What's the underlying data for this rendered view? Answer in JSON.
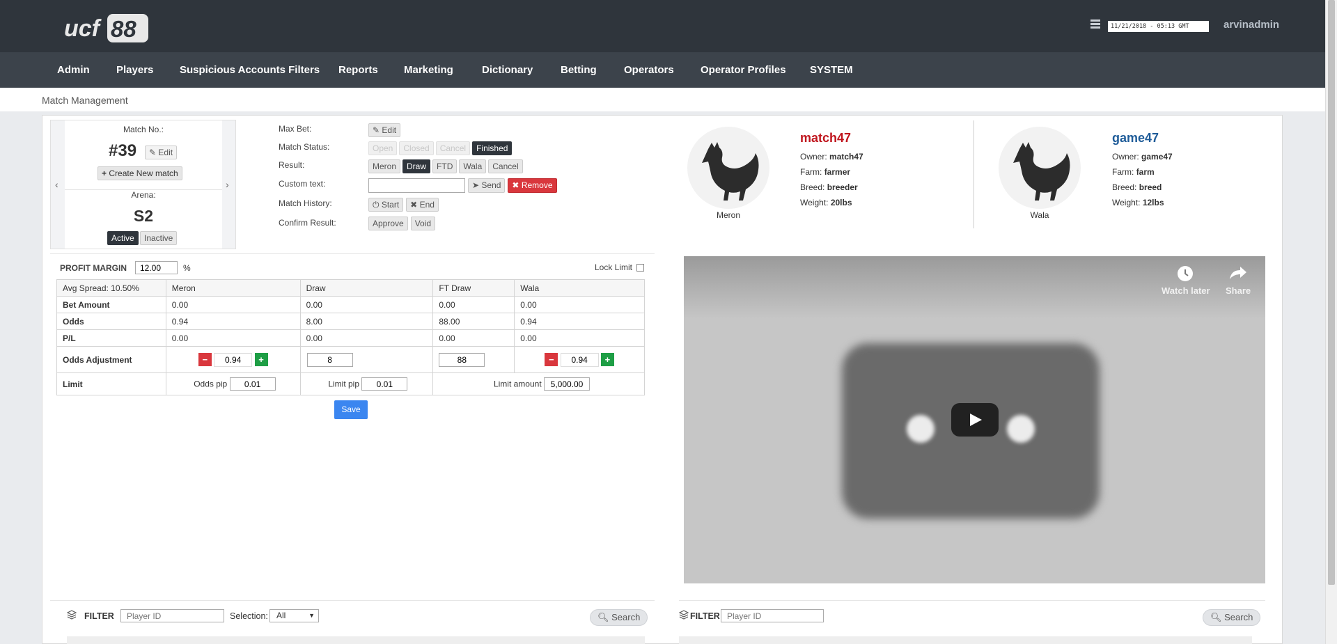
{
  "header": {
    "logo_text": "ucf88",
    "datetime": "11/21/2018 - 05:13 GMT",
    "username": "arvinadmin"
  },
  "nav": {
    "items": [
      "Admin",
      "Players",
      "Suspicious Accounts Filters",
      "Reports",
      "Marketing",
      "Dictionary",
      "Betting",
      "Operators",
      "Operator Profiles",
      "SYSTEM"
    ]
  },
  "breadcrumb": "Match Management",
  "match": {
    "number_label": "Match No.:",
    "number": "#39",
    "edit_label": "Edit",
    "create_label": "Create New match",
    "arena_label": "Arena:",
    "arena": "S2",
    "active_label": "Active",
    "inactive_label": "Inactive"
  },
  "controls": {
    "max_bet_label": "Max Bet:",
    "max_bet_edit": "Edit",
    "status_label": "Match Status:",
    "status_options": [
      "Open",
      "Closed",
      "Cancel",
      "Finished"
    ],
    "status_selected": "Finished",
    "result_label": "Result:",
    "result_options": [
      "Meron",
      "Draw",
      "FTD",
      "Wala",
      "Cancel"
    ],
    "result_selected": "Draw",
    "custom_text_label": "Custom text:",
    "custom_text_value": "",
    "send_label": "Send",
    "remove_label": "Remove",
    "history_label": "Match History:",
    "start_label": "Start",
    "end_label": "End",
    "confirm_label": "Confirm Result:",
    "approve_label": "Approve",
    "void_label": "Void"
  },
  "players": [
    {
      "name": "match47",
      "side": "Meron",
      "owner_label": "Owner:",
      "owner": "match47",
      "farm_label": "Farm:",
      "farm": "farmer",
      "breed_label": "Breed:",
      "breed": "breeder",
      "weight_label": "Weight:",
      "weight": "20lbs",
      "color": "#c0161e"
    },
    {
      "name": "game47",
      "side": "Wala",
      "owner_label": "Owner:",
      "owner": "game47",
      "farm_label": "Farm:",
      "farm": "farm",
      "breed_label": "Breed:",
      "breed": "breed",
      "weight_label": "Weight:",
      "weight": "12lbs",
      "color": "#1f5c99"
    }
  ],
  "profit": {
    "label": "PROFIT MARGIN",
    "value": "12.00",
    "unit": "%",
    "lock_label": "Lock Limit"
  },
  "odds_table": {
    "columns": [
      "Avg Spread: 10.50%",
      "Meron",
      "Draw",
      "FT Draw",
      "Wala"
    ],
    "rows": [
      {
        "label": "Bet Amount",
        "values": [
          "0.00",
          "0.00",
          "0.00",
          "0.00"
        ]
      },
      {
        "label": "Odds",
        "values": [
          "0.94",
          "8.00",
          "88.00",
          "0.94"
        ]
      },
      {
        "label": "P/L",
        "values": [
          "0.00",
          "0.00",
          "0.00",
          "0.00"
        ]
      }
    ],
    "adjust_label": "Odds Adjustment",
    "adjust_values": [
      "0.94",
      "8",
      "88",
      "0.94"
    ],
    "limit_label": "Limit",
    "odds_pip_label": "Odds pip",
    "odds_pip": "0.01",
    "limit_pip_label": "Limit pip",
    "limit_pip": "0.01",
    "limit_amount_label": "Limit amount",
    "limit_amount": "5,000.00",
    "save_label": "Save"
  },
  "video": {
    "watch_later": "Watch later",
    "share": "Share"
  },
  "filter_left": {
    "label": "FILTER",
    "player_placeholder": "Player ID",
    "selection_label": "Selection:",
    "selection_value": "All",
    "search_label": "Search"
  },
  "filter_right": {
    "label": "FILTER",
    "player_placeholder": "Player ID",
    "search_label": "Search"
  }
}
